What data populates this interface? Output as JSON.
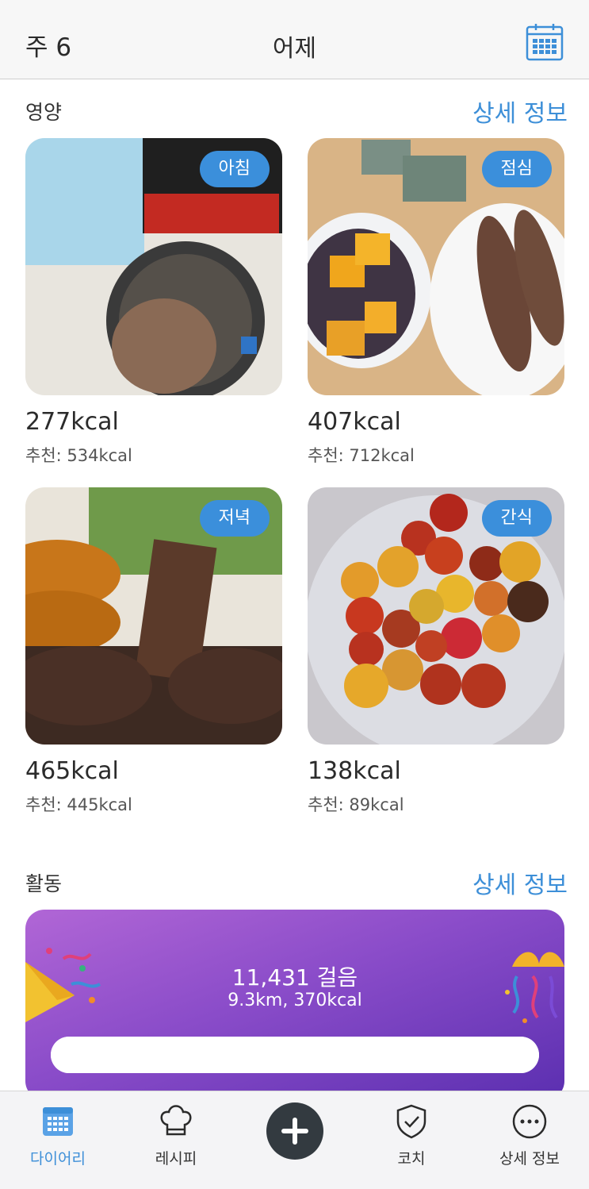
{
  "header": {
    "week": "주 6",
    "title": "어제"
  },
  "nutrition": {
    "title": "영양",
    "details": "상세 정보",
    "meals": [
      {
        "badge": "아침",
        "kcal": "277kcal",
        "recommended": "추천: 534kcal"
      },
      {
        "badge": "점심",
        "kcal": "407kcal",
        "recommended": "추천: 712kcal"
      },
      {
        "badge": "저녁",
        "kcal": "465kcal",
        "recommended": "추천: 445kcal"
      },
      {
        "badge": "간식",
        "kcal": "138kcal",
        "recommended": "추천: 89kcal"
      }
    ]
  },
  "activity": {
    "title": "활동",
    "details": "상세 정보",
    "steps": "11,431 걸음",
    "distance": "9.3km, 370kcal",
    "progress": 1.0
  },
  "tabs": [
    {
      "label": "다이어리",
      "icon": "calendar-icon",
      "active": true
    },
    {
      "label": "레시피",
      "icon": "chef-hat-icon",
      "active": false
    },
    {
      "label": "",
      "icon": "plus-icon",
      "active": false
    },
    {
      "label": "코치",
      "icon": "shield-check-icon",
      "active": false
    },
    {
      "label": "상세 정보",
      "icon": "more-icon",
      "active": false
    }
  ],
  "colors": {
    "accent": "#3d8fd8",
    "badge": "#3b8fdb",
    "activity_start": "#b166d6",
    "activity_end": "#5b2fb0",
    "add_button": "#333a40"
  }
}
